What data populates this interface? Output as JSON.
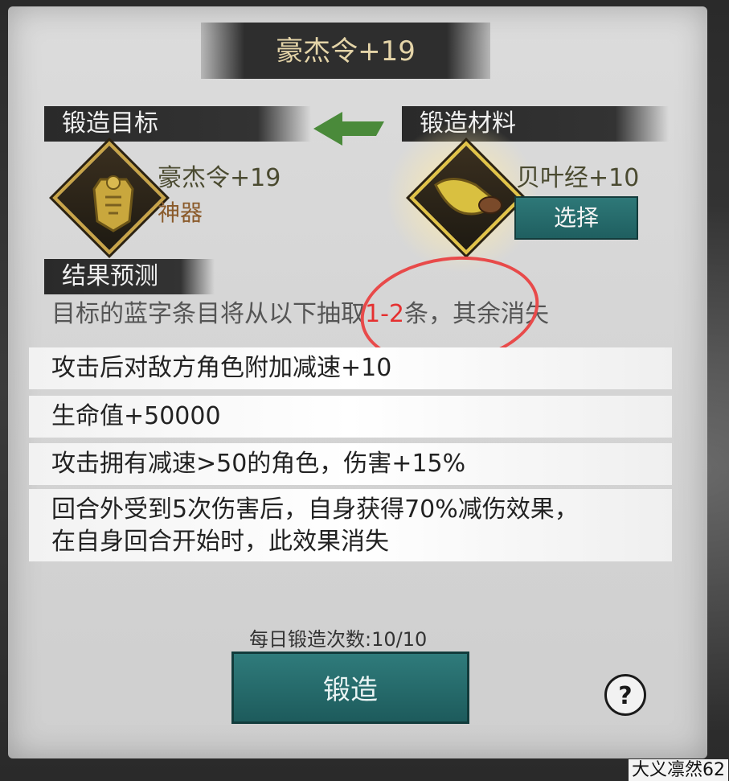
{
  "title": "豪杰令+19",
  "labels": {
    "target": "锻造目标",
    "material": "锻造材料",
    "result": "结果预测"
  },
  "target_item": {
    "name": "豪杰令+19",
    "quality": "神器",
    "icon": "token-icon"
  },
  "material_item": {
    "name": "贝叶经+10",
    "icon": "scroll-icon",
    "select_label": "选择"
  },
  "description": {
    "before": "目标的蓝字条目将从以下抽取",
    "highlight": "1-2",
    "after": "条，其余消失"
  },
  "stats": [
    "攻击后对敌方角色附加减速+10",
    "生命值+50000",
    "攻击拥有减速>50的角色，伤害+15%",
    "回合外受到5次伤害后，自身获得70%减伤效果，\n在自身回合开始时，此效果消失"
  ],
  "daily_count": "每日锻造次数:10/10",
  "forge_label": "锻造",
  "help_label": "?",
  "watermark": "大义凛然62",
  "colors": {
    "accent_teal": "#2a7070",
    "highlight_red": "#e53030",
    "gold": "#c8a448"
  }
}
